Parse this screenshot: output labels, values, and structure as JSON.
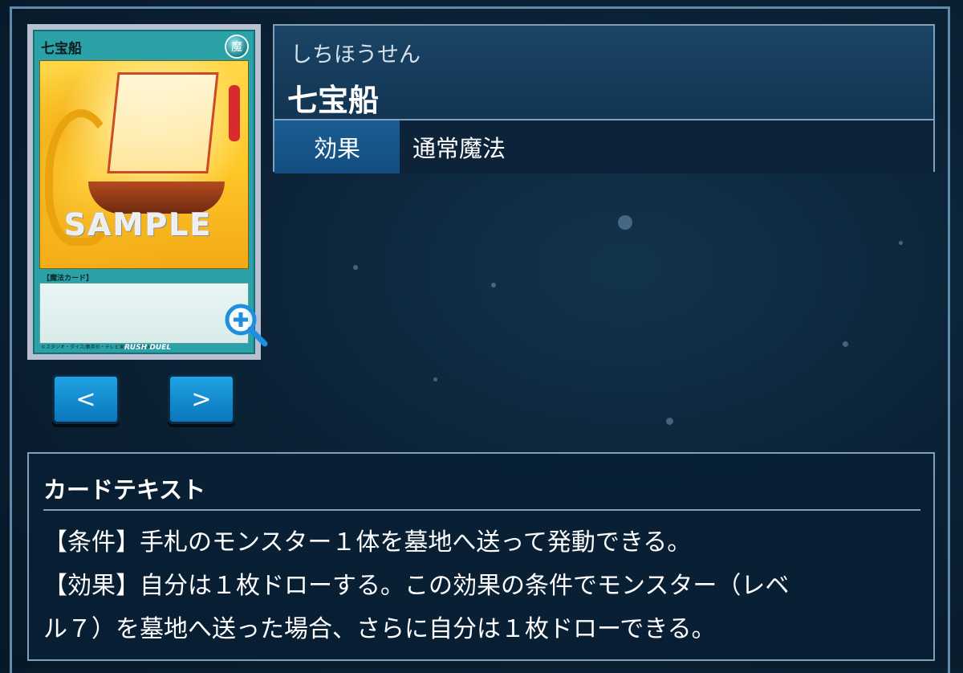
{
  "card": {
    "image": {
      "name": "七宝船",
      "attribute": "魔",
      "watermark": "SAMPLE",
      "type_label": "【魔法カード】",
      "copyright": "©スタジオ・ダイス/集英社・テレビ東京・KONAMI",
      "logo": "RUSH DUEL"
    },
    "ruby": "しちほうせん",
    "title": "七宝船",
    "attribute_label": "効果",
    "attribute_value": "通常魔法"
  },
  "nav": {
    "prev_label": "<",
    "next_label": ">"
  },
  "card_text": {
    "heading": "カードテキスト",
    "lines": [
      "【条件】手札のモンスター１体を墓地へ送って発動できる。",
      "【効果】自分は１枚ドローする。この効果の条件でモンスター（レベ",
      "ル７）を墓地へ送った場合、さらに自分は１枚ドローできる。"
    ]
  },
  "icons": {
    "zoom": "zoom-in-icon"
  },
  "colors": {
    "background": "#0b2236",
    "button": "#0a76bd",
    "label_bg": "#1a5d94",
    "border": "#7fa0b8"
  }
}
